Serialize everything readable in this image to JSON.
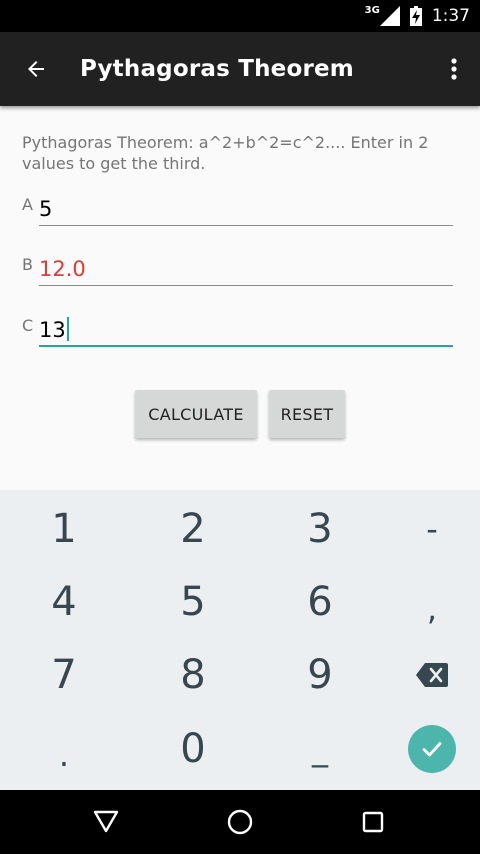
{
  "status_bar": {
    "network_type": "3G",
    "time": "1:37"
  },
  "app_bar": {
    "title": "Pythagoras Theorem"
  },
  "description": "Pythagoras Theorem: a^2+b^2=c^2.... Enter in 2 values to get the third.",
  "fields": [
    {
      "label": "A",
      "value": "5"
    },
    {
      "label": "B",
      "value": "12.0"
    },
    {
      "label": "C",
      "value": "13"
    }
  ],
  "buttons": {
    "calculate": "CALCULATE",
    "reset": "RESET"
  },
  "keyboard": {
    "keys": [
      "1",
      "2",
      "3",
      "-",
      "4",
      "5",
      "6",
      ",",
      "7",
      "8",
      "9",
      ".",
      "0",
      "_"
    ]
  },
  "colors": {
    "accent": "#26a69a",
    "error": "#e53935",
    "app_bar": "#212121",
    "keyboard_bg": "#eceff1"
  },
  "icons": [
    "back-arrow-icon",
    "overflow-menu-icon",
    "signal-icon",
    "battery-charging-icon",
    "backspace-icon",
    "check-icon",
    "nav-back-icon",
    "nav-home-icon",
    "nav-recents-icon"
  ]
}
